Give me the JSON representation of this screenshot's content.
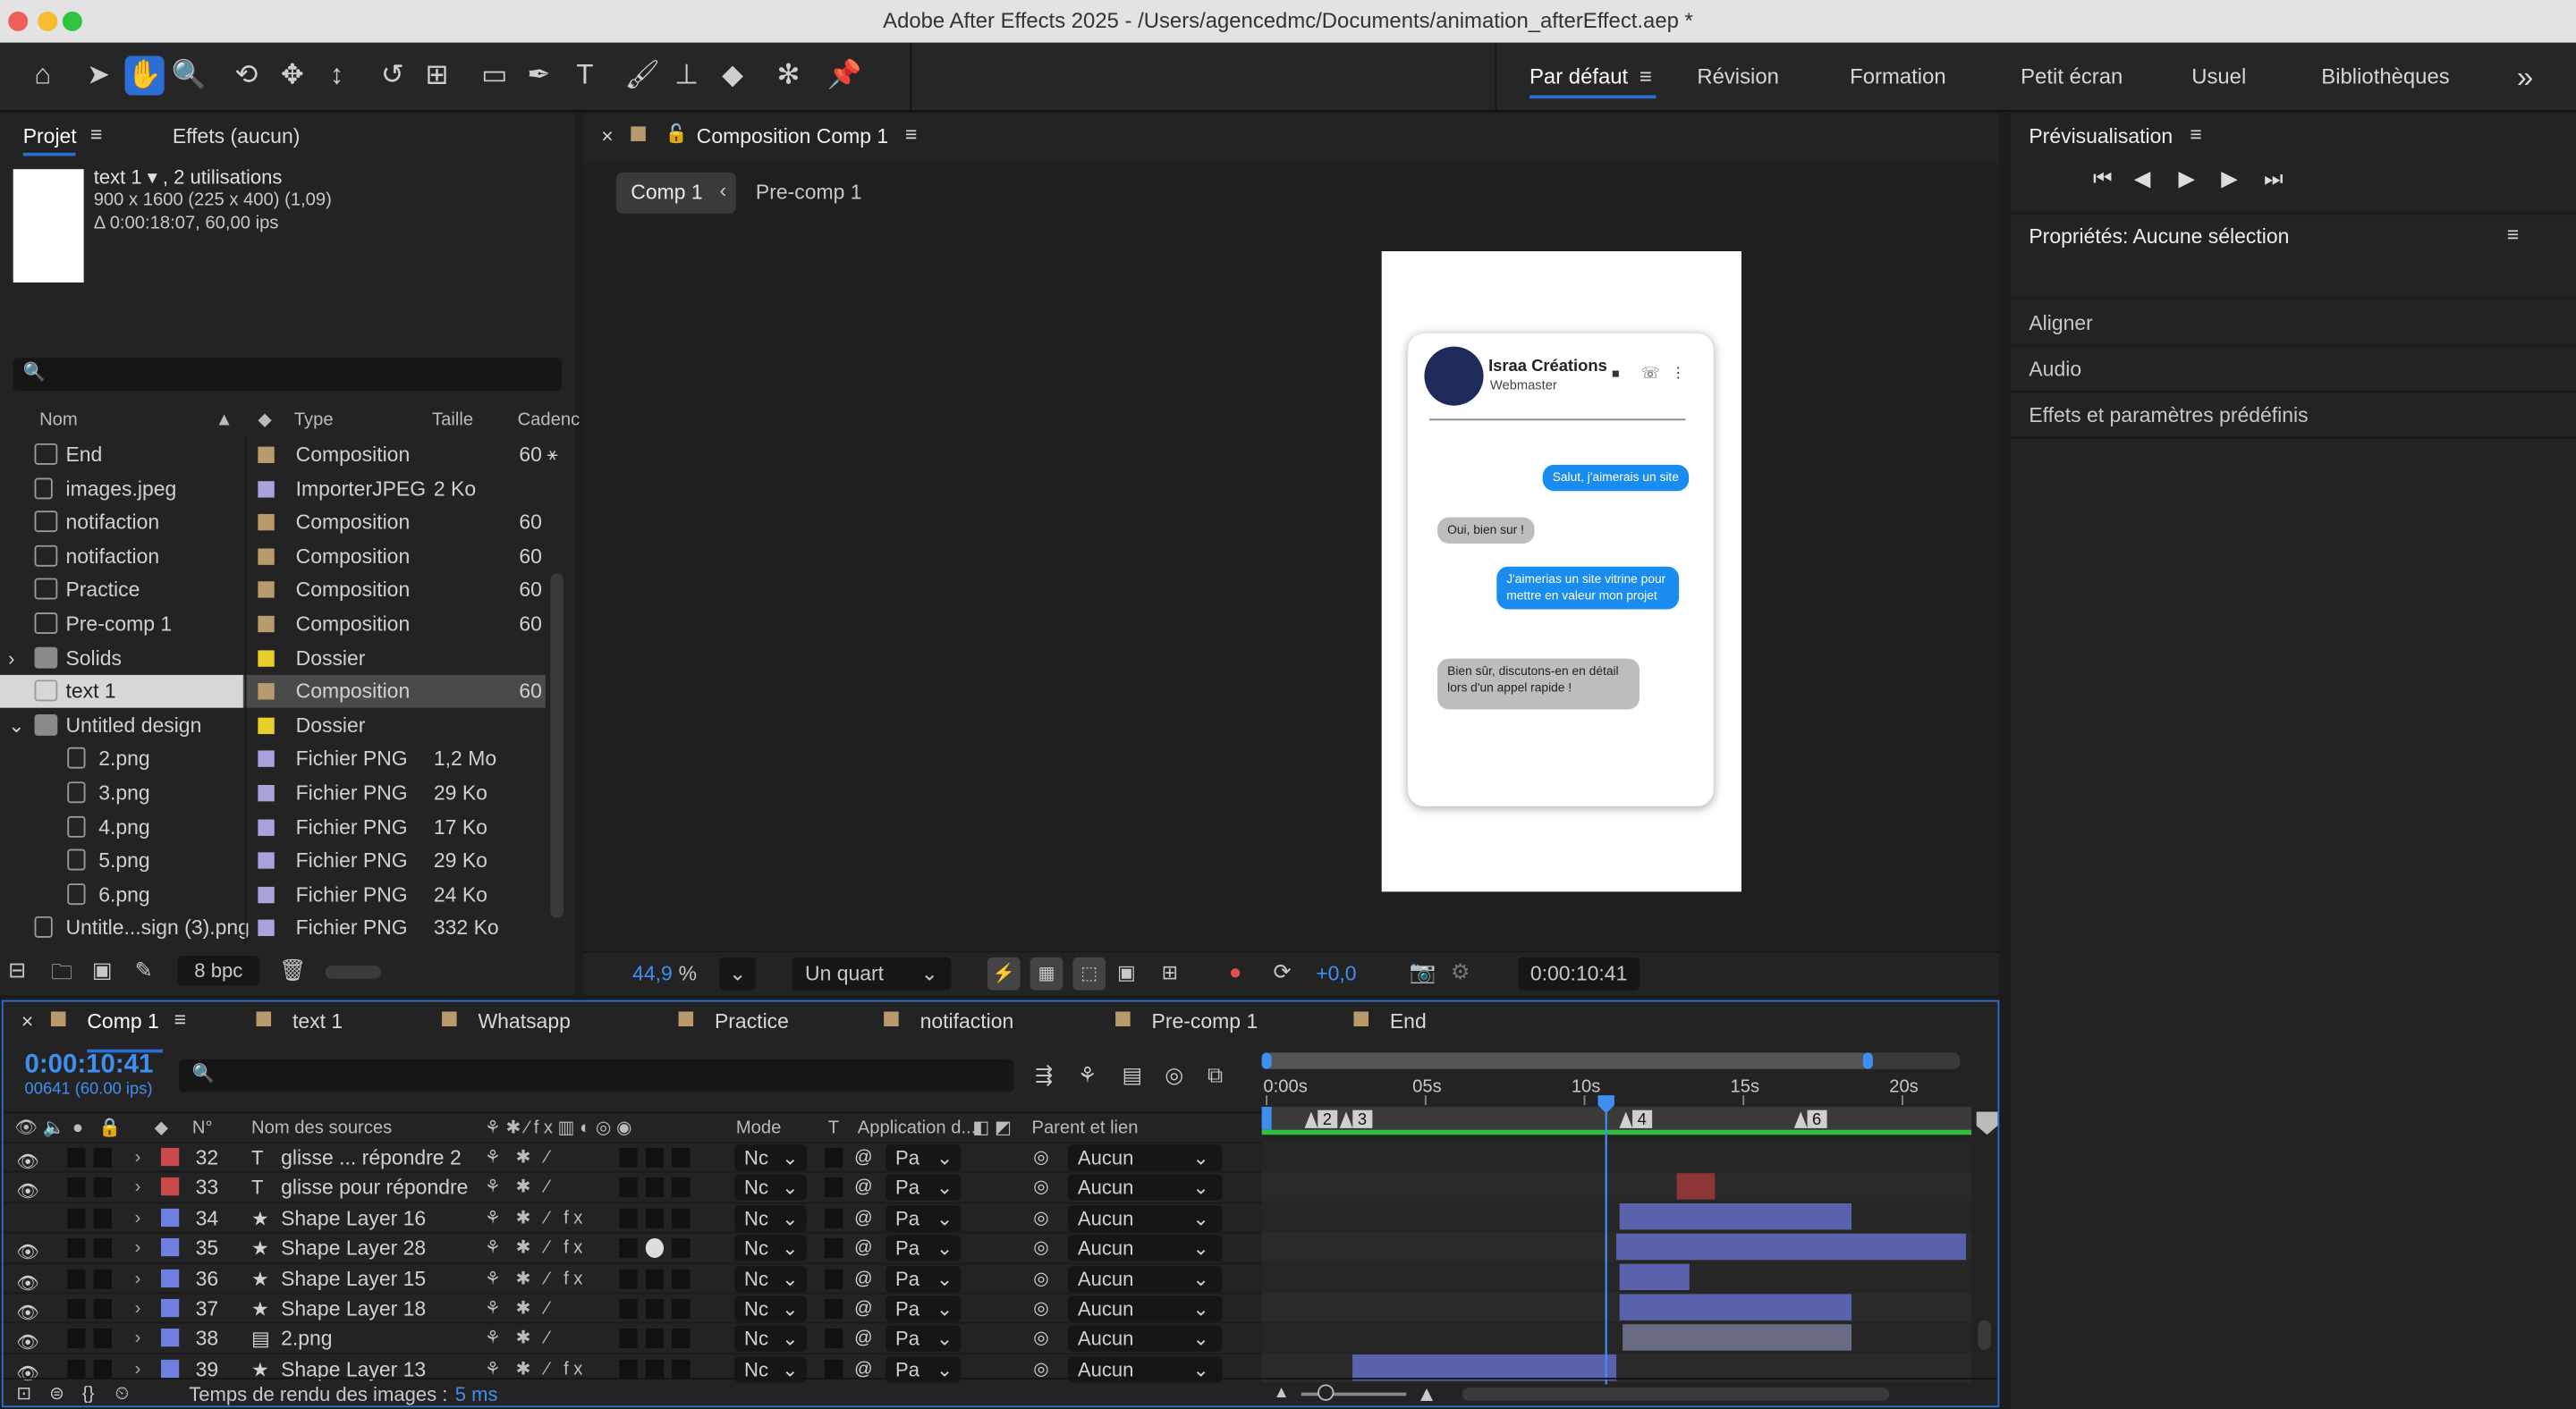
{
  "window": {
    "title": "Adobe After Effects 2025 - /Users/agencedmc/Documents/animation_afterEffect.aep *"
  },
  "workspaces": {
    "active": "Par défaut",
    "items": [
      "Révision",
      "Formation",
      "Petit écran",
      "Usuel",
      "Bibliothèques"
    ],
    "more": "»"
  },
  "project": {
    "tab_project": "Projet",
    "tab_effects": "Effets (aucun)",
    "info_name": "text 1 ▾ , 2 utilisations",
    "info_dims": "900 x 1600 (225 x 400) (1,09)",
    "info_dur": "Δ 0:00:18:07, 60,00 ips",
    "columns": {
      "name": "Nom",
      "type": "Type",
      "size": "Taille",
      "rate": "Cadenc"
    },
    "items": [
      {
        "name": "End",
        "type": "Composition",
        "size": "",
        "rate": "60",
        "label": "#b99a6d",
        "icon": "comp",
        "indent": 0,
        "selected": false
      },
      {
        "name": "images.jpeg",
        "type": "ImporterJPEG",
        "size": "2 Ko",
        "rate": "",
        "label": "#a9a3dc",
        "icon": "file",
        "indent": 0,
        "selected": false
      },
      {
        "name": "notifaction",
        "type": "Composition",
        "size": "",
        "rate": "60",
        "label": "#b99a6d",
        "icon": "comp",
        "indent": 0,
        "selected": false
      },
      {
        "name": "notifaction",
        "type": "Composition",
        "size": "",
        "rate": "60",
        "label": "#b99a6d",
        "icon": "comp",
        "indent": 0,
        "selected": false
      },
      {
        "name": "Practice",
        "type": "Composition",
        "size": "",
        "rate": "60",
        "label": "#b99a6d",
        "icon": "comp",
        "indent": 0,
        "selected": false
      },
      {
        "name": "Pre-comp 1",
        "type": "Composition",
        "size": "",
        "rate": "60",
        "label": "#b99a6d",
        "icon": "comp",
        "indent": 0,
        "selected": false
      },
      {
        "name": "Solids",
        "type": "Dossier",
        "size": "",
        "rate": "",
        "label": "#e8cf2b",
        "icon": "folder",
        "indent": 0,
        "selected": false,
        "twirl": "›"
      },
      {
        "name": "text 1",
        "type": "Composition",
        "size": "",
        "rate": "60",
        "label": "#b99a6d",
        "icon": "comp",
        "indent": 0,
        "selected": true
      },
      {
        "name": "Untitled design",
        "type": "Dossier",
        "size": "",
        "rate": "",
        "label": "#e8cf2b",
        "icon": "folder",
        "indent": 0,
        "selected": false,
        "twirl": "⌄"
      },
      {
        "name": "2.png",
        "type": "Fichier PNG",
        "size": "1,2 Mo",
        "rate": "",
        "label": "#a9a3dc",
        "icon": "file",
        "indent": 1,
        "selected": false
      },
      {
        "name": "3.png",
        "type": "Fichier PNG",
        "size": "29 Ko",
        "rate": "",
        "label": "#a9a3dc",
        "icon": "file",
        "indent": 1,
        "selected": false
      },
      {
        "name": "4.png",
        "type": "Fichier PNG",
        "size": "17 Ko",
        "rate": "",
        "label": "#a9a3dc",
        "icon": "file",
        "indent": 1,
        "selected": false
      },
      {
        "name": "5.png",
        "type": "Fichier PNG",
        "size": "29 Ko",
        "rate": "",
        "label": "#a9a3dc",
        "icon": "file",
        "indent": 1,
        "selected": false
      },
      {
        "name": "6.png",
        "type": "Fichier PNG",
        "size": "24 Ko",
        "rate": "",
        "label": "#a9a3dc",
        "icon": "file",
        "indent": 1,
        "selected": false
      },
      {
        "name": "Untitle...sign (3).png",
        "type": "Fichier PNG",
        "size": "332 Ko",
        "rate": "",
        "label": "#a9a3dc",
        "icon": "file",
        "indent": 0,
        "selected": false
      }
    ],
    "bpc": "8 bpc"
  },
  "composition": {
    "tab": "Composition Comp 1",
    "crumb_active": "Comp 1",
    "crumb_next": "Pre-comp 1",
    "zoom": "44,9",
    "zoom_unit": "%",
    "resolution": "Un quart",
    "exposure": "+0,0",
    "timecode": "0:00:10:41"
  },
  "phone": {
    "contact": "Israa Créations",
    "subtitle": "Webmaster",
    "msg1": "Salut, j'aimerais un site",
    "msg2": "Oui, bien sur !",
    "msg3": "J'aimerias un site vitrine pour mettre en valeur mon projet",
    "msg4": "Bien sûr, discutons-en en détail lors d'un appel rapide !"
  },
  "preview": {
    "title": "Prévisualisation"
  },
  "properties": {
    "title": "Propriétés: Aucune sélection",
    "sections": [
      "Aligner",
      "Audio",
      "Effets et paramètres prédéfinis"
    ]
  },
  "timeline": {
    "tabs": [
      "Comp 1",
      "text 1",
      "Whatsapp",
      "Practice",
      "notifaction",
      "Pre-comp 1",
      "End"
    ],
    "timecode": "0:00:10:41",
    "frames": "00641 (60.00 ips)",
    "col_num": "N°",
    "col_source": "Nom des sources",
    "col_mode": "Mode",
    "col_t": "T",
    "col_app": "Application d...",
    "col_parent": "Parent et lien",
    "ruler": [
      "0:00s",
      "05s",
      "10s",
      "15s",
      "20s"
    ],
    "markers": [
      "2",
      "3",
      "4",
      "6"
    ],
    "layers": [
      {
        "num": "32",
        "type": "T",
        "name": "glisse ... répondre 2",
        "label": "#c94a4a",
        "mode": "Nc",
        "app": "Pa",
        "parent": "Aucun",
        "fx": false,
        "eye": true,
        "start": 0,
        "end": 0,
        "bar": ""
      },
      {
        "num": "33",
        "type": "T",
        "name": "glisse pour répondre",
        "label": "#c94a4a",
        "mode": "Nc",
        "app": "Pa",
        "parent": "Aucun",
        "fx": false,
        "eye": true,
        "start": 12.9,
        "end": 14.1,
        "bar": "#8e3636"
      },
      {
        "num": "34",
        "type": "★",
        "name": "Shape Layer 16",
        "label": "#6f7fe0",
        "mode": "Nc",
        "app": "Pa",
        "parent": "Aucun",
        "fx": true,
        "eye": false,
        "start": 11.1,
        "end": 18.4,
        "bar": "#5a62ad"
      },
      {
        "num": "35",
        "type": "★",
        "name": "Shape Layer 28",
        "label": "#6f7fe0",
        "mode": "Nc",
        "app": "Pa",
        "parent": "Aucun",
        "fx": true,
        "eye": true,
        "start": 11.0,
        "end": 22.0,
        "bar": "#5a62ad"
      },
      {
        "num": "36",
        "type": "★",
        "name": "Shape Layer 15",
        "label": "#6f7fe0",
        "mode": "Nc",
        "app": "Pa",
        "parent": "Aucun",
        "fx": true,
        "eye": true,
        "start": 11.1,
        "end": 13.3,
        "bar": "#5a62ad"
      },
      {
        "num": "37",
        "type": "★",
        "name": "Shape Layer 18",
        "label": "#6f7fe0",
        "mode": "Nc",
        "app": "Pa",
        "parent": "Aucun",
        "fx": false,
        "eye": true,
        "start": 11.1,
        "end": 18.4,
        "bar": "#5a62ad"
      },
      {
        "num": "38",
        "type": "▤",
        "name": "2.png",
        "label": "#6f7fe0",
        "mode": "Nc",
        "app": "Pa",
        "parent": "Aucun",
        "fx": false,
        "eye": true,
        "start": 11.2,
        "end": 18.4,
        "bar": "#6a6c86"
      },
      {
        "num": "39",
        "type": "★",
        "name": "Shape Layer 13",
        "label": "#6f7fe0",
        "mode": "Nc",
        "app": "Pa",
        "parent": "Aucun",
        "fx": true,
        "eye": true,
        "start": 2.7,
        "end": 11.0,
        "bar": "#5a62ad"
      }
    ],
    "render_label": "Temps de rendu des images :",
    "render_value": "5 ms"
  },
  "colors": {
    "accent": "#2b6fd6",
    "timecode": "#3f8ff0",
    "bubble_blue": "#1a8cf0",
    "bubble_gray": "#bdbdbd"
  }
}
